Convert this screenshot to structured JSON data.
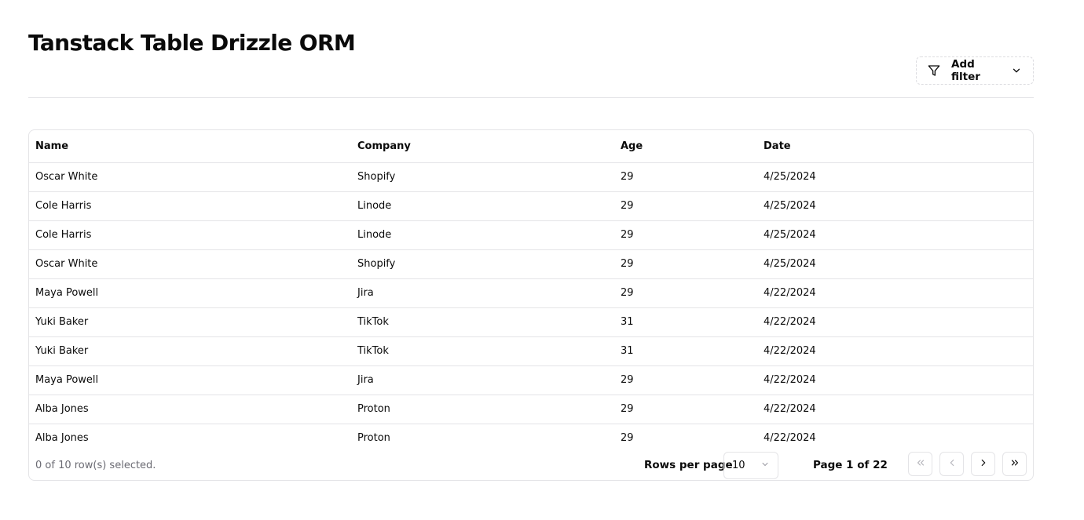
{
  "page": {
    "title": "Tanstack Table Drizzle ORM"
  },
  "filter": {
    "label": "Add filter",
    "icon": "filter-icon"
  },
  "table": {
    "columns": [
      "Name",
      "Company",
      "Age",
      "Date"
    ],
    "rows": [
      [
        "Oscar White",
        "Shopify",
        "29",
        "4/25/2024"
      ],
      [
        "Cole Harris",
        "Linode",
        "29",
        "4/25/2024"
      ],
      [
        "Cole Harris",
        "Linode",
        "29",
        "4/25/2024"
      ],
      [
        "Oscar White",
        "Shopify",
        "29",
        "4/25/2024"
      ],
      [
        "Maya Powell",
        "Jira",
        "29",
        "4/22/2024"
      ],
      [
        "Yuki Baker",
        "TikTok",
        "31",
        "4/22/2024"
      ],
      [
        "Yuki Baker",
        "TikTok",
        "31",
        "4/22/2024"
      ],
      [
        "Maya Powell",
        "Jira",
        "29",
        "4/22/2024"
      ],
      [
        "Alba Jones",
        "Proton",
        "29",
        "4/22/2024"
      ],
      [
        "Alba Jones",
        "Proton",
        "29",
        "4/22/2024"
      ]
    ]
  },
  "footer": {
    "selection_text": "0 of 10 row(s) selected.",
    "rows_per_page_label": "Rows per page",
    "rows_per_page_value": "10",
    "page_text": "Page 1 of 22"
  }
}
